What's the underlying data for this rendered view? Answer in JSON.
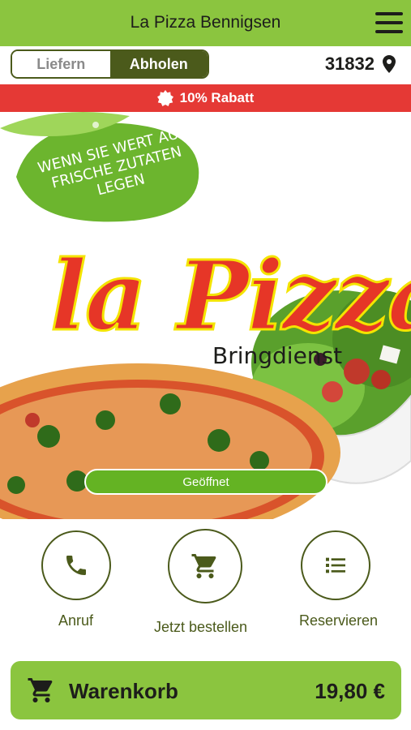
{
  "header": {
    "title": "La Pizza Bennigsen",
    "menu_icon": "hamburger-menu-icon"
  },
  "delivery_toggle": {
    "options": [
      "Liefern",
      "Abholen"
    ],
    "selected": "Abholen"
  },
  "location": {
    "zip": "31832",
    "icon": "map-pin-icon"
  },
  "promo": {
    "text": "10% Rabatt",
    "icon": "discount-badge-icon"
  },
  "hero": {
    "leaf_text": "Wenn Sie Wert auf frische Zutaten legen",
    "logo": "la Pizza",
    "logo_sub": "Bringdienst",
    "status": "Geöffnet"
  },
  "actions": [
    {
      "label": "Anruf",
      "icon": "phone-icon"
    },
    {
      "label": "Jetzt bestellen",
      "icon": "cart-icon"
    },
    {
      "label": "Reservieren",
      "icon": "list-icon"
    }
  ],
  "cart": {
    "label": "Warenkorb",
    "total": "19,80 €",
    "icon": "cart-icon"
  },
  "colors": {
    "brand_green": "#8bc53f",
    "dark_olive": "#4b5a1b",
    "promo_red": "#e53935",
    "status_green": "#64b323",
    "logo_red": "#e63627"
  }
}
